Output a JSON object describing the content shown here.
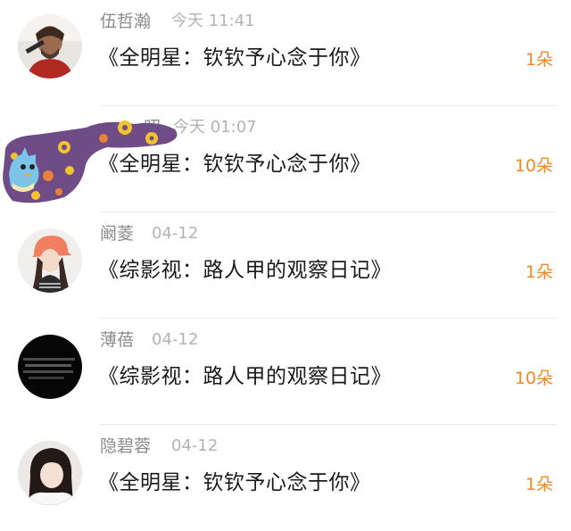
{
  "gifts": [
    {
      "user": "伍哲瀚",
      "time": "今天 11:41",
      "title": "《全明星：钦钦予心念于你》",
      "count": "1朵",
      "avatar": "person-avatar-icon"
    },
    {
      "user": "…昭",
      "time": "今天 01:07",
      "title": "《全明星：钦钦予心念于你》",
      "count": "10朵",
      "avatar": "cartoon-avatar-icon"
    },
    {
      "user": "阚菱",
      "time": "04-12",
      "title": "《综影视：路人甲的观察日记》",
      "count": "1朵",
      "avatar": "person-avatar-icon"
    },
    {
      "user": "薄蓓",
      "time": "04-12",
      "title": "《综影视：路人甲的观察日记》",
      "count": "10朵",
      "avatar": "dark-text-avatar-icon"
    },
    {
      "user": "隐碧蓉",
      "time": "04-12",
      "title": "《全明星：钦钦予心念于你》",
      "count": "1朵",
      "avatar": "person-avatar-icon"
    }
  ],
  "colors": {
    "accent": "#f08a24",
    "name": "#8c8c8c",
    "time": "#b3b3b3",
    "title": "#1a1a1a",
    "divider": "#ececec"
  }
}
